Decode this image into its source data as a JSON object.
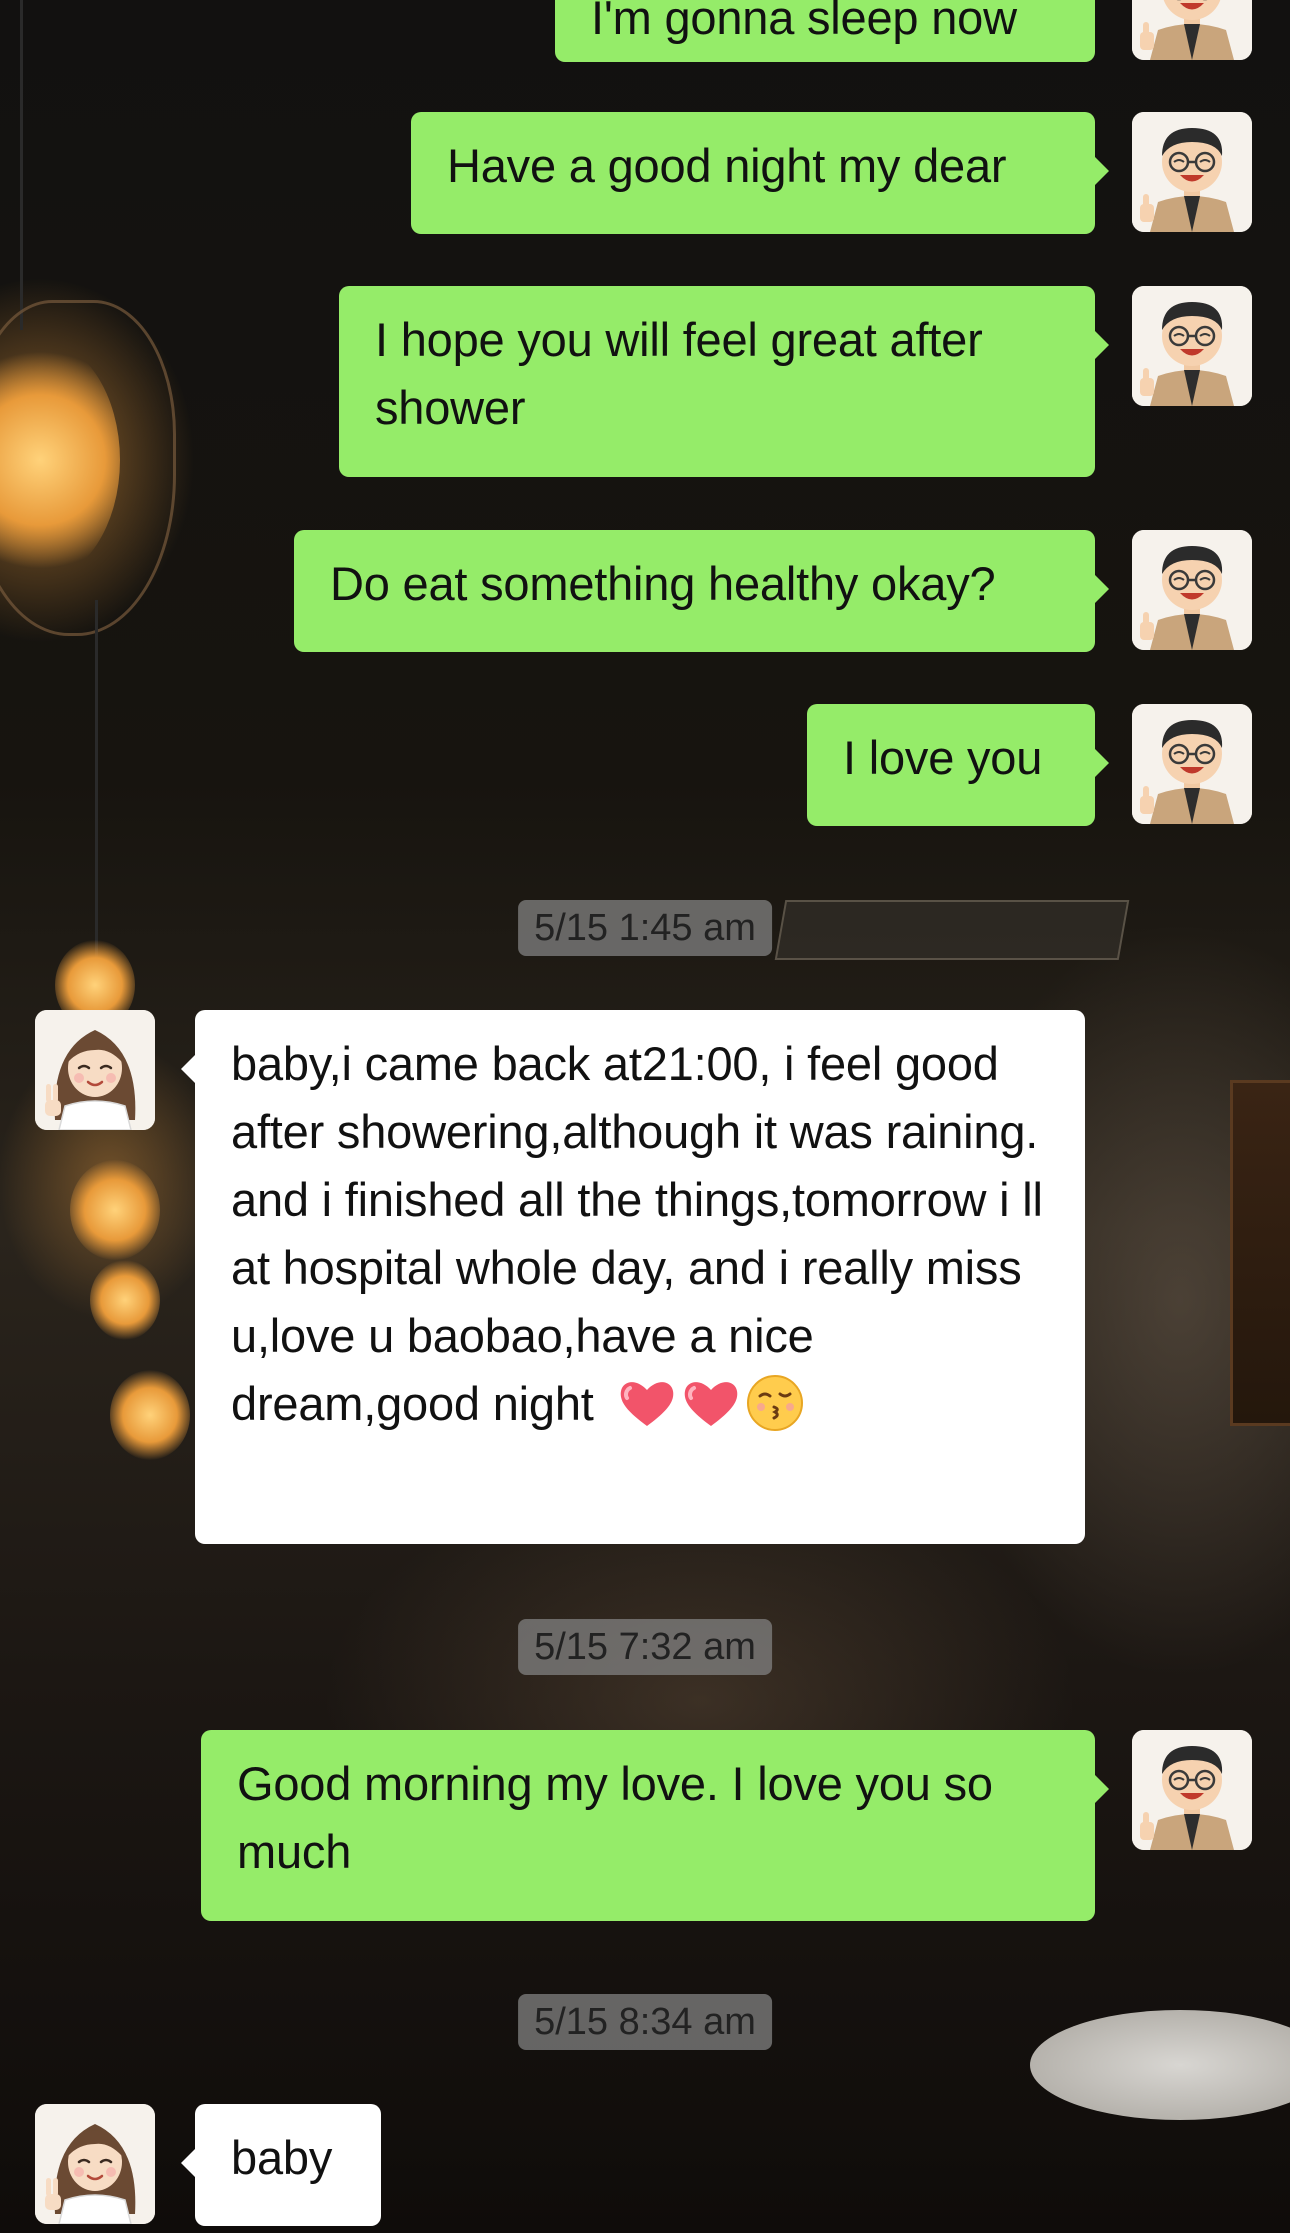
{
  "chat": {
    "messages": [
      {
        "sender": "me",
        "text": "I'm gonna sleep now"
      },
      {
        "sender": "me",
        "text": "Have a good night my dear"
      },
      {
        "sender": "me",
        "text": "I hope you will feel great after shower"
      },
      {
        "sender": "me",
        "text": "Do eat something healthy okay?"
      },
      {
        "sender": "me",
        "text": "I love you"
      },
      {
        "timestamp": "5/15 1:45 am"
      },
      {
        "sender": "other",
        "text": "baby,i came back at21:00, i feel good after showering,although  it was raining. and i finished all the things,tomorrow i ll at hospital whole day, and i really miss u,love u baobao,have a nice dream,good night",
        "emojis": [
          "red-heart",
          "red-heart",
          "kissing-face"
        ]
      },
      {
        "timestamp": "5/15 7:32 am"
      },
      {
        "sender": "me",
        "text": "Good morning my love. I love you so much"
      },
      {
        "timestamp": "5/15 8:34 am"
      },
      {
        "sender": "other",
        "text": "baby"
      }
    ]
  },
  "colors": {
    "my_bubble": "#95ec69",
    "their_bubble": "#ffffff",
    "timestamp_bg": "#828282"
  },
  "icons": {
    "my_avatar": "cartoon-man-glasses-thumbs-up-avatar",
    "their_avatar": "cartoon-woman-peace-sign-avatar"
  }
}
